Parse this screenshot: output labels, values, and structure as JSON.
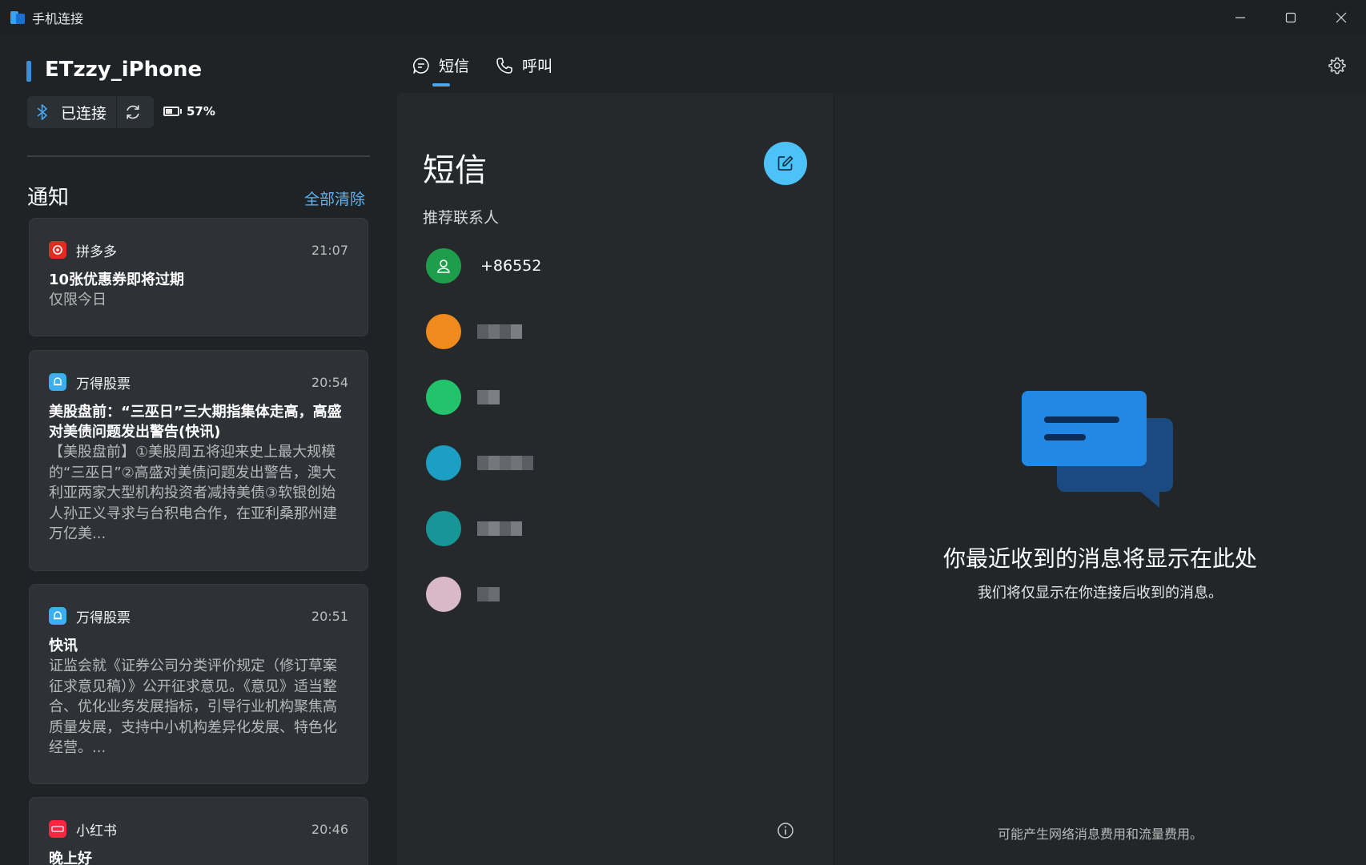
{
  "window": {
    "title": "手机连接"
  },
  "device": {
    "name": "ETzzy_iPhone",
    "status": "已连接",
    "battery": "57%",
    "battery_level": 0.57
  },
  "notifications": {
    "title": "通知",
    "clear_all": "全部清除",
    "items": [
      {
        "app": "拼多多",
        "time": "21:07",
        "title": "10张优惠券即将过期",
        "body": "仅限今日",
        "icon_color": "#e02e24",
        "icon": "pinduoduo-icon"
      },
      {
        "app": "万得股票",
        "time": "20:54",
        "title": "美股盘前：“三巫日”三大期指集体走高，高盛对美债问题发出警告(快讯)",
        "body": "【美股盘前】①美股周五将迎来史上最大规模的“三巫日”②高盛对美债问题发出警告，澳大利亚两家大型机构投资者减持美债③软银创始人孙正义寻求与台积电合作，在亚利桑那州建万亿美...",
        "icon_color": "#3ab0f0",
        "icon": "bell-icon"
      },
      {
        "app": "万得股票",
        "time": "20:51",
        "title": "快讯",
        "body": "证监会就《证券公司分类评价规定（修订草案征求意见稿）》公开征求意见。《意见》适当整合、优化业务发展指标，引导行业机构聚焦高质量发展，支持中小机构差异化发展、特色化经营。...",
        "icon_color": "#3ab0f0",
        "icon": "bell-icon"
      },
      {
        "app": "小红书",
        "time": "20:46",
        "title": "晚上好",
        "body": "",
        "icon_color": "#ff2442",
        "icon": "xiaohongshu-icon"
      }
    ]
  },
  "tabs": [
    {
      "label": "短信",
      "icon": "message-icon",
      "active": true
    },
    {
      "label": "呼叫",
      "icon": "phone-icon",
      "active": false
    }
  ],
  "messages": {
    "title": "短信",
    "recommended_label": "推荐联系人",
    "contacts": [
      {
        "name": "+86552",
        "avatar_color": "#1e9e4a"
      },
      {
        "name": "",
        "avatar_color": "#f08a1c"
      },
      {
        "name": "",
        "avatar_color": "#22c36a"
      },
      {
        "name": "",
        "avatar_color": "#1b9fc4"
      },
      {
        "name": "",
        "avatar_color": "#169696"
      },
      {
        "name": "",
        "avatar_color": "#d9b8c8"
      }
    ]
  },
  "empty_state": {
    "title": "你最近收到的消息将显示在此处",
    "subtitle": "我们将仅显示在你连接后收到的消息。",
    "fee_note": "可能产生网络消息费用和流量费用。"
  },
  "colors": {
    "accent": "#4aa8f2",
    "compose_button": "#4cc2f8"
  }
}
